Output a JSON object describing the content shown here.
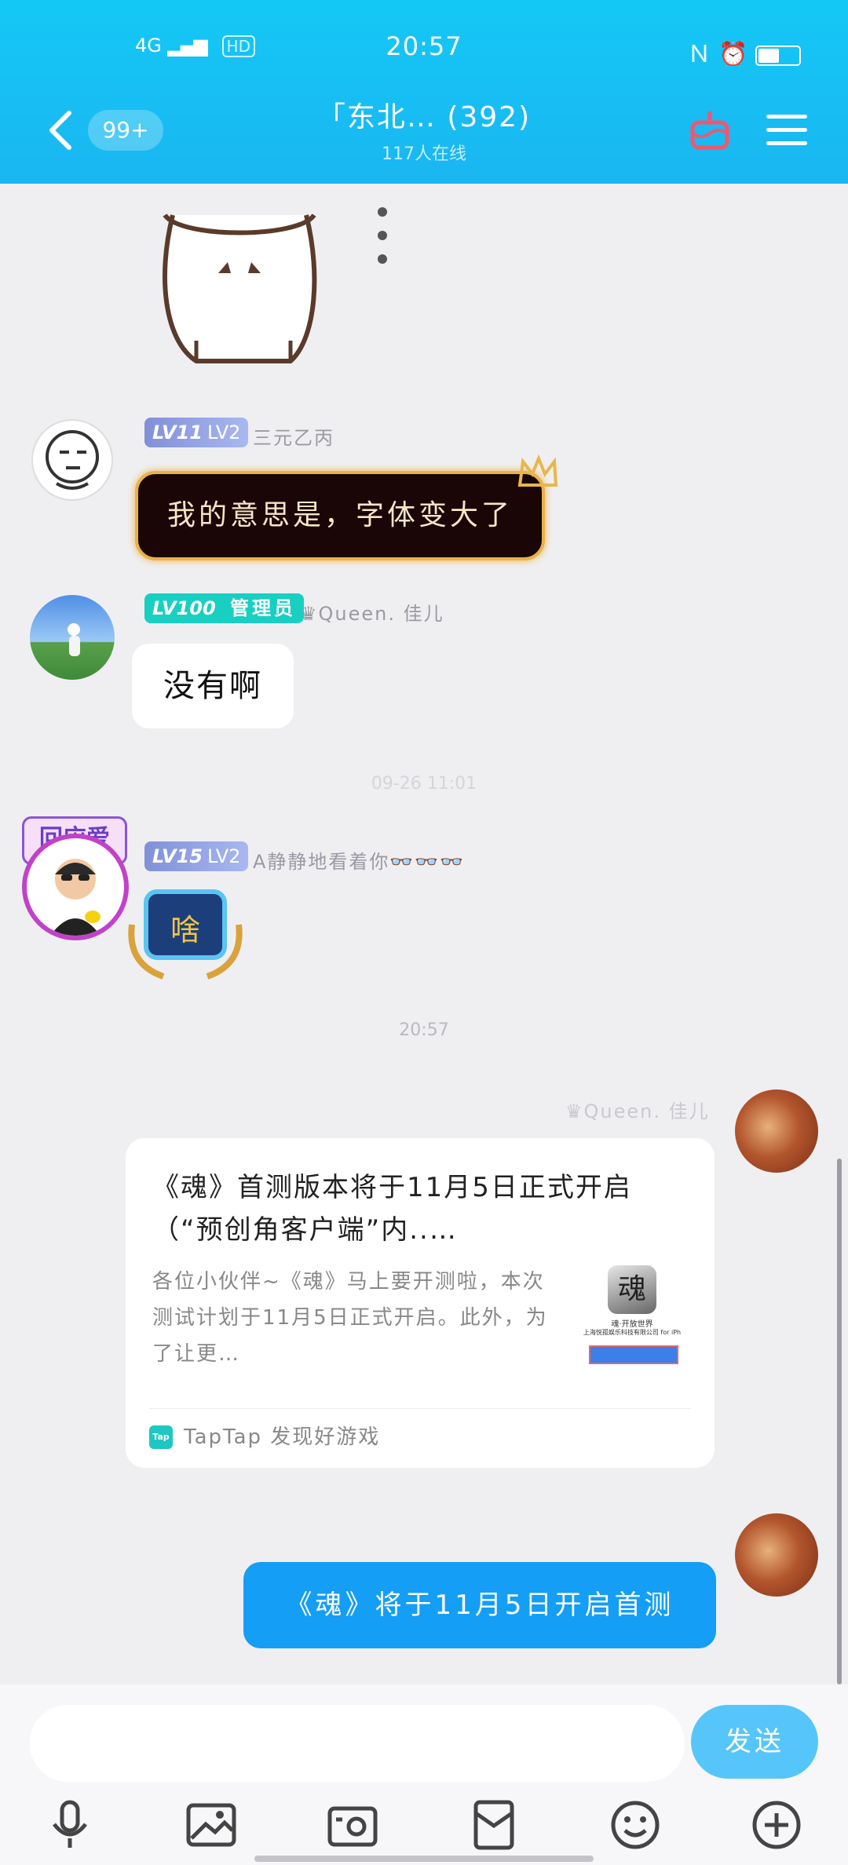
{
  "status_bar": {
    "network": "4G",
    "hd": "HD",
    "time": "20:57",
    "right_icons": [
      "nfc-icon",
      "alarm-icon",
      "battery-icon"
    ]
  },
  "header": {
    "unread_count": "99+",
    "group_title": "「东北… (392)",
    "online_count": "117人在线"
  },
  "messages": [
    {
      "level": "LV11",
      "sublevel": "LV2",
      "nickname": "三元乙丙",
      "text": "我的意思是，字体变大了"
    },
    {
      "level": "LV100",
      "role": "管理员",
      "nickname": "♛Queen. 佳儿",
      "text": "没有啊"
    },
    {
      "timestamp": "09-26 11:01"
    },
    {
      "level": "LV15",
      "sublevel": "LV2",
      "nickname": "A静静地看着你👓👓👓",
      "avatar_badge": "回应爱",
      "sticker_text": "啥"
    },
    {
      "timestamp": "20:57"
    },
    {
      "nickname": "♛Queen. 佳儿",
      "card": {
        "title": "《魂》首测版本将于11月5日正式开启（“预创角客户端”内..…",
        "description": "各位小伙伴~《魂》马上要开测啦，本次测试计划于11月5日正式开启。此外，为了让更…",
        "thumb_char": "魂",
        "thumb_caption": "魂·开放世界",
        "thumb_company": "上海悦孤娱乐科技有限公司 for iPh",
        "source": "TapTap 发现好游戏",
        "source_logo": "Tap"
      }
    },
    {
      "text": "《魂》将于11月5日开启首测"
    }
  ],
  "input": {
    "placeholder": "",
    "send_label": "发送"
  },
  "toolbar": [
    "microphone-icon",
    "image-icon",
    "camera-icon",
    "red-packet-icon",
    "emoji-icon",
    "plus-icon"
  ],
  "colors": {
    "header_blue": "#14c8f6",
    "outgoing_bubble": "#149ef5",
    "admin_badge": "#18cfc2",
    "level_badge": "#8d9ee4",
    "send_button": "#56c6fa"
  }
}
